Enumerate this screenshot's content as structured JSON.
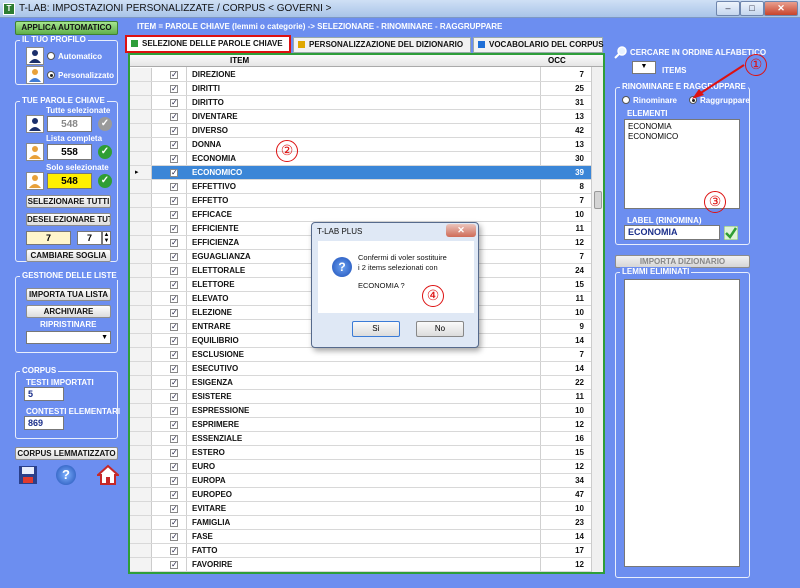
{
  "window": {
    "title": "T-LAB: IMPOSTAZIONI PERSONALIZZATE  /  CORPUS < GOVERNI >",
    "app_icon_text": "T",
    "min_label": "–",
    "max_label": "□",
    "close_label": "✕"
  },
  "left": {
    "apply_button": "APPLICA AUTOMATICO",
    "profile": {
      "title": "IL TUO PROFILO",
      "automatic": "Automatico",
      "custom": "Personalizzato"
    },
    "keywords": {
      "title": "TUE PAROLE CHIAVE",
      "all_selected_label": "Tutte selezionate",
      "all_selected_value": "548",
      "full_list_label": "Lista completa",
      "full_list_value": "558",
      "only_selected_label": "Solo selezionate",
      "only_selected_value": "548",
      "select_all": "SELEZIONARE TUTTI",
      "deselect_all": "DESELEZIONARE TUTTI",
      "threshold_a": "7",
      "threshold_b": "7",
      "change_threshold": "CAMBIARE SOGLIA"
    },
    "lists": {
      "title": "GESTIONE DELLE LISTE",
      "import": "IMPORTA TUA LISTA",
      "archive": "ARCHIVIARE",
      "restore_label": "RIPRISTINARE",
      "restore_value": ""
    },
    "corpus": {
      "title": "CORPUS",
      "texts_label": "TESTI IMPORTATI",
      "texts_value": "5",
      "contexts_label": "CONTESTI ELEMENTARI",
      "contexts_value": "869"
    },
    "lemmatized_button": "CORPUS LEMMATIZZATO"
  },
  "header_text": "ITEM = PAROLE CHIAVE (lemmi o categorie) -> SELEZIONARE - RINOMINARE - RAGGRUPPARE",
  "tabs": [
    {
      "label": "SELEZIONE DELLE PAROLE CHIAVE",
      "color": "#2e9e3a"
    },
    {
      "label": "PERSONALIZZAZIONE DEL DIZIONARIO",
      "color": "#e0a800"
    },
    {
      "label": "VOCABOLARIO DEL CORPUS",
      "color": "#1f6fd6"
    }
  ],
  "grid": {
    "col_item": "ITEM",
    "col_occ": "OCC",
    "current_row_marker": "▸",
    "check_mark": "✓",
    "rows": [
      {
        "item": "DIREZIONE",
        "occ": "7"
      },
      {
        "item": "DIRITTI",
        "occ": "25"
      },
      {
        "item": "DIRITTO",
        "occ": "31"
      },
      {
        "item": "DIVENTARE",
        "occ": "13"
      },
      {
        "item": "DIVERSO",
        "occ": "42"
      },
      {
        "item": "DONNA",
        "occ": "13"
      },
      {
        "item": "ECONOMIA",
        "occ": "30"
      },
      {
        "item": "ECONOMICO",
        "occ": "39",
        "selected": true
      },
      {
        "item": "EFFETTIVO",
        "occ": "8"
      },
      {
        "item": "EFFETTO",
        "occ": "7"
      },
      {
        "item": "EFFICACE",
        "occ": "10"
      },
      {
        "item": "EFFICIENTE",
        "occ": "11"
      },
      {
        "item": "EFFICIENZA",
        "occ": "12"
      },
      {
        "item": "EGUAGLIANZA",
        "occ": "7"
      },
      {
        "item": "ELETTORALE",
        "occ": "24"
      },
      {
        "item": "ELETTORE",
        "occ": "15"
      },
      {
        "item": "ELEVATO",
        "occ": "11"
      },
      {
        "item": "ELEZIONE",
        "occ": "10"
      },
      {
        "item": "ENTRARE",
        "occ": "9"
      },
      {
        "item": "EQUILIBRIO",
        "occ": "14"
      },
      {
        "item": "ESCLUSIONE",
        "occ": "7"
      },
      {
        "item": "ESECUTIVO",
        "occ": "14"
      },
      {
        "item": "ESIGENZA",
        "occ": "22"
      },
      {
        "item": "ESISTERE",
        "occ": "11"
      },
      {
        "item": "ESPRESSIONE",
        "occ": "10"
      },
      {
        "item": "ESPRIMERE",
        "occ": "12"
      },
      {
        "item": "ESSENZIALE",
        "occ": "16"
      },
      {
        "item": "ESTERO",
        "occ": "15"
      },
      {
        "item": "EURO",
        "occ": "12"
      },
      {
        "item": "EUROPA",
        "occ": "34"
      },
      {
        "item": "EUROPEO",
        "occ": "47"
      },
      {
        "item": "EVITARE",
        "occ": "10"
      },
      {
        "item": "FAMIGLIA",
        "occ": "23"
      },
      {
        "item": "FASE",
        "occ": "14"
      },
      {
        "item": "FATTO",
        "occ": "17"
      },
      {
        "item": "FAVORIRE",
        "occ": "12"
      }
    ]
  },
  "right": {
    "alpha_search_label": "CERCARE IN ORDINE ALFABETICO",
    "items_label": "ITEMS",
    "rename_group_title": "RINOMINARE E RAGGRUPPARE",
    "rename_option": "Rinominare",
    "group_option": "Raggruppare",
    "elements_label": "ELEMENTI",
    "elements": [
      "ECONOMIA",
      "ECONOMICO"
    ],
    "label_title": "LABEL (RINOMINA)",
    "label_value": "ECONOMIA",
    "import_dict": "IMPORTA DIZIONARIO",
    "removed_title": "LEMMI ELIMINATI"
  },
  "dialog": {
    "title": "T-LAB PLUS",
    "close": "✕",
    "message_line1": "Confermi di voler sostituire",
    "message_line2": "i 2 items selezionati con",
    "message_line3": "ECONOMIA ?",
    "yes": "Sì",
    "no": "No",
    "icon": "?"
  },
  "markers": [
    "①",
    "②",
    "③",
    "④"
  ],
  "colors": {
    "background": "#6c8ef0",
    "selection": "#3b86d7",
    "annotation": "#d11111",
    "grid_border": "#2e9e3a"
  }
}
